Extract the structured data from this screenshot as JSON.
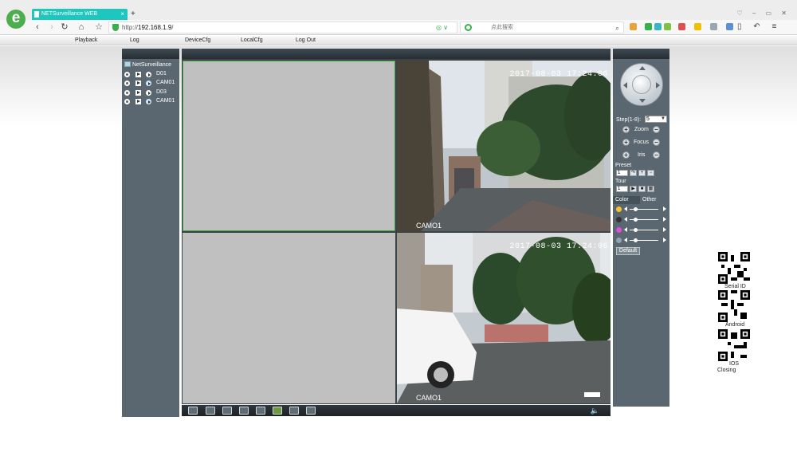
{
  "browser": {
    "tab_title": "NETSurveillance WEB",
    "tab_close": "×",
    "new_tab": "+",
    "url_prefix": "http://",
    "url_host": "192.168.1.9",
    "url_suffix": "/",
    "search_placeholder": "点此搜索",
    "window_controls": "♡ – ▭ ✕"
  },
  "menu": {
    "items": [
      "Playback",
      "Log",
      "DeviceCfg",
      "LocalCfg",
      "Log Out"
    ]
  },
  "device_tree": {
    "root": "NetSurveillance",
    "channels": [
      {
        "label": "D01",
        "live": false
      },
      {
        "label": "CAM01",
        "live": true
      },
      {
        "label": "D03",
        "live": false
      },
      {
        "label": "CAM01",
        "live": true
      }
    ]
  },
  "video": {
    "views": [
      {
        "state": "empty"
      },
      {
        "timestamp": "2017-08-03 17:24:06",
        "name": "CAMO1"
      },
      {
        "state": "empty"
      },
      {
        "timestamp": "2017-08-03 17:24:06",
        "name": "CAMO1"
      }
    ]
  },
  "ptz": {
    "step_label": "Step(1-8):",
    "step_value": "5",
    "zoom_label": "Zoom",
    "focus_label": "Focus",
    "iris_label": "Iris",
    "preset_label": "Preset",
    "preset_value": "1",
    "tour_label": "Tour",
    "tour_value": "1"
  },
  "color_panel": {
    "tab_color": "Color",
    "tab_other": "Other",
    "sliders": [
      {
        "name": "brightness",
        "color": "#f6c431",
        "level": 0.2
      },
      {
        "name": "contrast",
        "color": "#333333",
        "level": 0.2
      },
      {
        "name": "saturation",
        "color": "#d94fd6",
        "level": 0.2
      },
      {
        "name": "hue",
        "color": "#8fa3b3",
        "level": 0.2
      }
    ],
    "default_label": "Default"
  },
  "qr_codes": {
    "serial": "Serial ID",
    "android": "Android",
    "ios": "IOS",
    "closing": "Closing"
  },
  "bottom_bar": {
    "volume_icon": "🔈"
  }
}
